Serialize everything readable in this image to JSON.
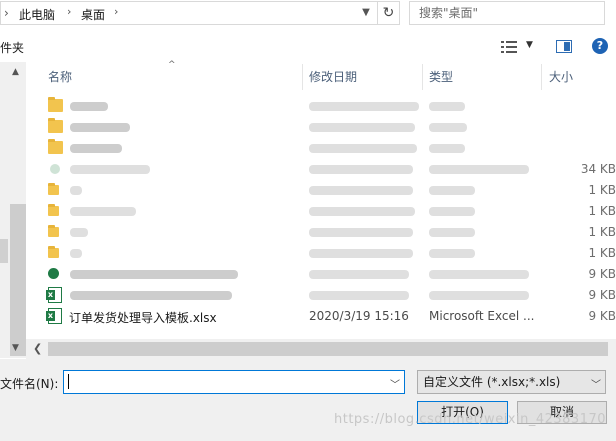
{
  "address": {
    "crumbs": [
      "此电脑",
      "桌面"
    ]
  },
  "search": {
    "placeholder": "搜索\"桌面\""
  },
  "toolbar": {
    "left_label": "件夹"
  },
  "columns": {
    "name": "名称",
    "date": "修改日期",
    "type": "类型",
    "size": "大小"
  },
  "rows": [
    {
      "size": ""
    },
    {
      "size": ""
    },
    {
      "size": ""
    },
    {
      "size": "34 KB"
    },
    {
      "size": "1 KB"
    },
    {
      "size": "1 KB"
    },
    {
      "size": "1 KB"
    },
    {
      "size": "1 KB"
    },
    {
      "size": "9 KB"
    },
    {
      "size": "9 KB"
    }
  ],
  "visible_file": {
    "name": "订单发货处理导入模板.xlsx",
    "date": "2020/3/19 15:16",
    "type": "Microsoft Excel ...",
    "size": "9 KB"
  },
  "footer": {
    "filename_label": "文件名(N):",
    "filename_value": "",
    "filter_value": "自定义文件 (*.xlsx;*.xls)",
    "open_label": "打开(O)",
    "cancel_label": "取消"
  },
  "watermark": "https://blog.csdn.net/weixin_42383170"
}
